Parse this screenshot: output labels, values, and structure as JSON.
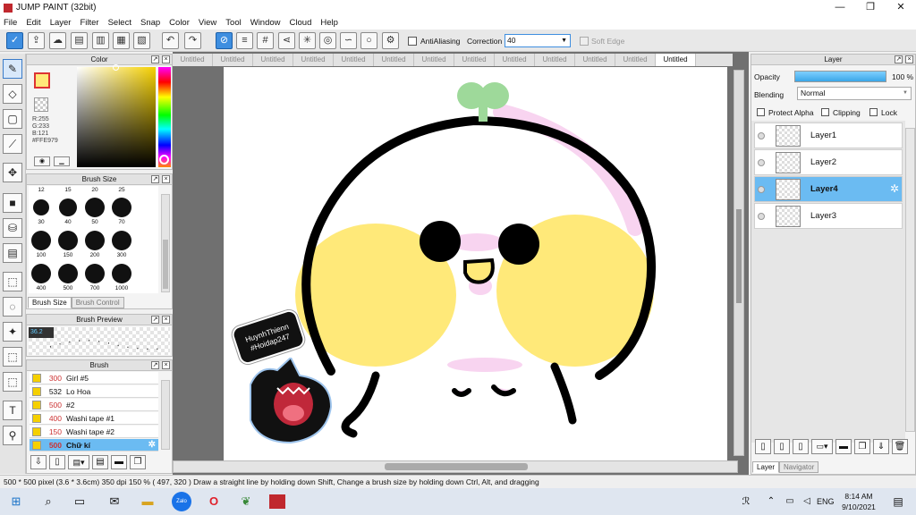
{
  "window": {
    "title": "JUMP PAINT (32bit)",
    "minimize": "—",
    "maximize": "❐",
    "close": "✕"
  },
  "menu": [
    "File",
    "Edit",
    "Layer",
    "Filter",
    "Select",
    "Snap",
    "Color",
    "View",
    "Tool",
    "Window",
    "Cloud",
    "Help"
  ],
  "toolbar": {
    "antialiasing_label": "AntiAliasing",
    "correction_label": "Correction",
    "correction_value": "40",
    "soft_edge_label": "Soft Edge"
  },
  "color_panel": {
    "title": "Color",
    "r": "R:255",
    "g": "G:233",
    "b": "B:121",
    "hex": "#FFE979",
    "current_color": "#FFE979"
  },
  "brush_size_panel": {
    "title": "Brush Size",
    "top_row": [
      "12",
      "15",
      "20",
      "25"
    ],
    "sizes": [
      [
        "30",
        "40",
        "50",
        "70"
      ],
      [
        "100",
        "150",
        "200",
        "300"
      ],
      [
        "400",
        "500",
        "700",
        "1000"
      ]
    ],
    "tabs": [
      "Brush Size",
      "Brush Control"
    ]
  },
  "brush_preview": {
    "title": "Brush Preview",
    "value": "36.2"
  },
  "brush_panel": {
    "title": "Brush",
    "items": [
      {
        "size": "300",
        "name": "Girl #5"
      },
      {
        "size": "532",
        "name": "Lo Hoa"
      },
      {
        "size": "500",
        "name": "#2"
      },
      {
        "size": "400",
        "name": "Washi tape #1"
      },
      {
        "size": "150",
        "name": "Washi tape #2"
      },
      {
        "size": "500",
        "name": "Chữ kí"
      }
    ]
  },
  "doc_tabs": [
    "Untitled",
    "Untitled",
    "Untitled",
    "Untitled",
    "Untitled",
    "Untitled",
    "Untitled",
    "Untitled",
    "Untitled",
    "Untitled",
    "Untitled",
    "Untitled",
    "Untitled"
  ],
  "sticker": {
    "line1": "HuynhThienn",
    "line2": "#Hoidap247"
  },
  "layer_panel": {
    "title": "Layer",
    "opacity_label": "Opacity",
    "opacity_value": "100 %",
    "opacity_fraction": 1.0,
    "blending_label": "Blending",
    "blending_value": "Normal",
    "protect_alpha": "Protect Alpha",
    "clipping": "Clipping",
    "lock": "Lock",
    "layers": [
      "Layer1",
      "Layer2",
      "Layer4",
      "Layer3"
    ],
    "tabs": [
      "Layer",
      "Navigator"
    ]
  },
  "status": {
    "text": "500 * 500 pixel   (3.6 * 3.6cm)   350 dpi   150 %   ( 497, 320 )   Draw a straight line by holding down Shift, Change a brush size by holding down Ctrl, Alt, and dragging"
  },
  "taskbar": {
    "language": "ENG",
    "time": "8:14 AM",
    "date": "9/10/2021",
    "zalo_label": "Zalo"
  },
  "colors": {
    "accent": "#3e8ee0",
    "selection": "#6bbbf2",
    "cheek_yellow": "#FFE979",
    "pink": "#F8D4F0",
    "sprout_green": "#9ED99A"
  }
}
